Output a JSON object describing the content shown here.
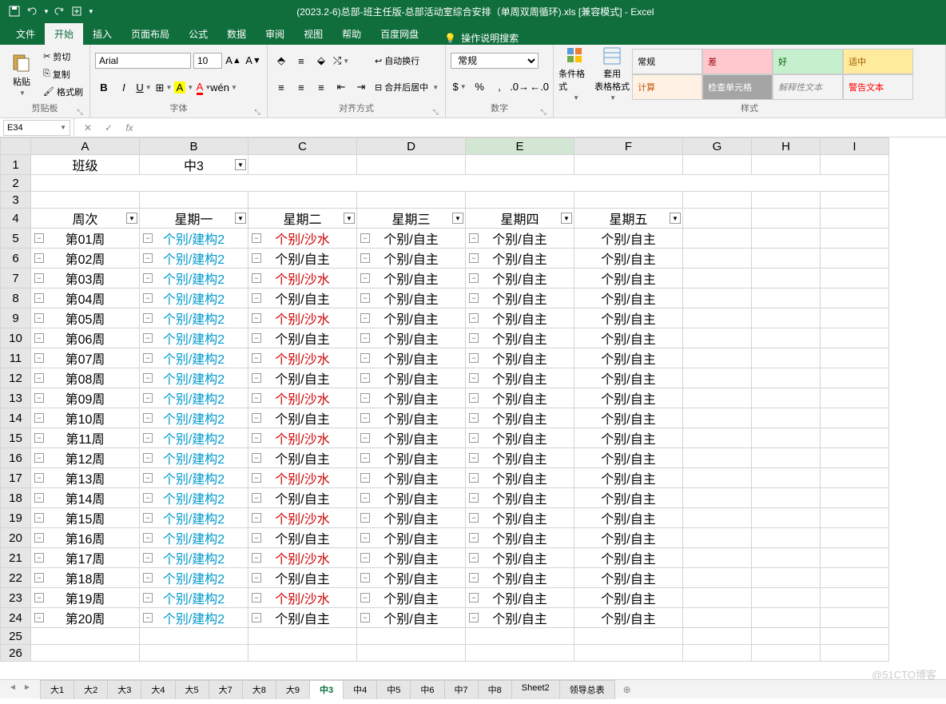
{
  "title": "(2023.2-6)总部-班主任版-总部活动室综合安排（单周双周循环).xls [兼容模式] - Excel",
  "tabs": {
    "file": "文件",
    "home": "开始",
    "insert": "插入",
    "layout": "页面布局",
    "formula": "公式",
    "data": "数据",
    "review": "审阅",
    "view": "视图",
    "help": "帮助",
    "baidu": "百度网盘",
    "tell": "操作说明搜索"
  },
  "ribbon": {
    "clipboard": {
      "paste": "粘贴",
      "cut": "剪切",
      "copy": "复制",
      "painter": "格式刷",
      "label": "剪贴板"
    },
    "font": {
      "name": "Arial",
      "size": "10",
      "label": "字体"
    },
    "align": {
      "wrap": "自动换行",
      "merge": "合并后居中",
      "label": "对齐方式"
    },
    "number": {
      "format": "常规",
      "label": "数字"
    },
    "styles": {
      "cond": "条件格式",
      "table": "套用\n表格格式",
      "normal": "常规",
      "bad": "差",
      "good": "好",
      "neutral": "适中",
      "calc": "计算",
      "check": "检查单元格",
      "explain": "解释性文本",
      "warn": "警告文本",
      "label": "样式"
    }
  },
  "namebox": "E34",
  "grid": {
    "cols": [
      "A",
      "B",
      "C",
      "D",
      "E",
      "F",
      "G",
      "H",
      "I"
    ],
    "r1": {
      "a": "班级",
      "b": "中3"
    },
    "r4": {
      "a": "周次",
      "b": "星期一",
      "c": "星期二",
      "d": "星期三",
      "e": "星期四",
      "f": "星期五"
    },
    "rows": [
      {
        "n": 5,
        "a": "第01周",
        "b": "个别/建构2",
        "c": "个别/沙水",
        "d": "个别/自主",
        "e": "个别/自主",
        "f": "个别/自主",
        "cred": true
      },
      {
        "n": 6,
        "a": "第02周",
        "b": "个别/建构2",
        "c": "个别/自主",
        "d": "个别/自主",
        "e": "个别/自主",
        "f": "个别/自主",
        "cred": false
      },
      {
        "n": 7,
        "a": "第03周",
        "b": "个别/建构2",
        "c": "个别/沙水",
        "d": "个别/自主",
        "e": "个别/自主",
        "f": "个别/自主",
        "cred": true
      },
      {
        "n": 8,
        "a": "第04周",
        "b": "个别/建构2",
        "c": "个别/自主",
        "d": "个别/自主",
        "e": "个别/自主",
        "f": "个别/自主",
        "cred": false
      },
      {
        "n": 9,
        "a": "第05周",
        "b": "个别/建构2",
        "c": "个别/沙水",
        "d": "个别/自主",
        "e": "个别/自主",
        "f": "个别/自主",
        "cred": true
      },
      {
        "n": 10,
        "a": "第06周",
        "b": "个别/建构2",
        "c": "个别/自主",
        "d": "个别/自主",
        "e": "个别/自主",
        "f": "个别/自主",
        "cred": false
      },
      {
        "n": 11,
        "a": "第07周",
        "b": "个别/建构2",
        "c": "个别/沙水",
        "d": "个别/自主",
        "e": "个别/自主",
        "f": "个别/自主",
        "cred": true
      },
      {
        "n": 12,
        "a": "第08周",
        "b": "个别/建构2",
        "c": "个别/自主",
        "d": "个别/自主",
        "e": "个别/自主",
        "f": "个别/自主",
        "cred": false
      },
      {
        "n": 13,
        "a": "第09周",
        "b": "个别/建构2",
        "c": "个别/沙水",
        "d": "个别/自主",
        "e": "个别/自主",
        "f": "个别/自主",
        "cred": true
      },
      {
        "n": 14,
        "a": "第10周",
        "b": "个别/建构2",
        "c": "个别/自主",
        "d": "个别/自主",
        "e": "个别/自主",
        "f": "个别/自主",
        "cred": false
      },
      {
        "n": 15,
        "a": "第11周",
        "b": "个别/建构2",
        "c": "个别/沙水",
        "d": "个别/自主",
        "e": "个别/自主",
        "f": "个别/自主",
        "cred": true
      },
      {
        "n": 16,
        "a": "第12周",
        "b": "个别/建构2",
        "c": "个别/自主",
        "d": "个别/自主",
        "e": "个别/自主",
        "f": "个别/自主",
        "cred": false
      },
      {
        "n": 17,
        "a": "第13周",
        "b": "个别/建构2",
        "c": "个别/沙水",
        "d": "个别/自主",
        "e": "个别/自主",
        "f": "个别/自主",
        "cred": true
      },
      {
        "n": 18,
        "a": "第14周",
        "b": "个别/建构2",
        "c": "个别/自主",
        "d": "个别/自主",
        "e": "个别/自主",
        "f": "个别/自主",
        "cred": false
      },
      {
        "n": 19,
        "a": "第15周",
        "b": "个别/建构2",
        "c": "个别/沙水",
        "d": "个别/自主",
        "e": "个别/自主",
        "f": "个别/自主",
        "cred": true
      },
      {
        "n": 20,
        "a": "第16周",
        "b": "个别/建构2",
        "c": "个别/自主",
        "d": "个别/自主",
        "e": "个别/自主",
        "f": "个别/自主",
        "cred": false
      },
      {
        "n": 21,
        "a": "第17周",
        "b": "个别/建构2",
        "c": "个别/沙水",
        "d": "个别/自主",
        "e": "个别/自主",
        "f": "个别/自主",
        "cred": true
      },
      {
        "n": 22,
        "a": "第18周",
        "b": "个别/建构2",
        "c": "个别/自主",
        "d": "个别/自主",
        "e": "个别/自主",
        "f": "个别/自主",
        "cred": false
      },
      {
        "n": 23,
        "a": "第19周",
        "b": "个别/建构2",
        "c": "个别/沙水",
        "d": "个别/自主",
        "e": "个别/自主",
        "f": "个别/自主",
        "cred": true
      },
      {
        "n": 24,
        "a": "第20周",
        "b": "个别/建构2",
        "c": "个别/自主",
        "d": "个别/自主",
        "e": "个别/自主",
        "f": "个别/自主",
        "cred": false
      }
    ]
  },
  "sheets": [
    "大1",
    "大2",
    "大3",
    "大4",
    "大5",
    "大7",
    "大8",
    "大9",
    "中3",
    "中4",
    "中5",
    "中6",
    "中7",
    "中8",
    "Sheet2",
    "领导总表"
  ],
  "active_sheet": "中3",
  "watermark": "@51CTO博客"
}
